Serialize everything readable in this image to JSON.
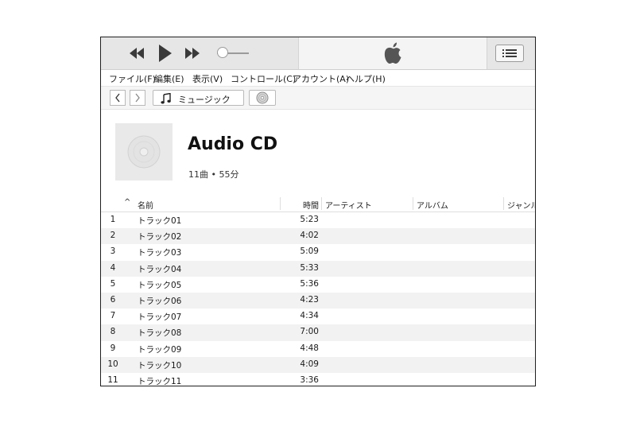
{
  "menu": [
    {
      "label": "ファイル(F)"
    },
    {
      "label": "編集(E)"
    },
    {
      "label": "表示(V)"
    },
    {
      "label": "コントロール(C)"
    },
    {
      "label": "アカウント(A)"
    },
    {
      "label": "ヘルプ(H)"
    }
  ],
  "player": {
    "icons": [
      "rewind-icon",
      "play-icon",
      "fast-forward-icon",
      "apple-logo-icon",
      "list-view-icon"
    ],
    "volume_level": 0.15
  },
  "nav": {
    "source_label": "ミュージック",
    "icons": [
      "back-arrow-icon",
      "forward-arrow-icon",
      "music-note-icon",
      "cd-icon"
    ]
  },
  "album": {
    "title": "Audio CD",
    "summary": "11曲 • 55分"
  },
  "table": {
    "sort_indicator": "^",
    "headers": {
      "name": "名前",
      "time": "時間",
      "artist": "アーティスト",
      "album": "アルバム",
      "genre": "ジャンル"
    },
    "rows": [
      {
        "num": "1",
        "name": "トラック01",
        "time": "5:23"
      },
      {
        "num": "2",
        "name": "トラック02",
        "time": "4:02"
      },
      {
        "num": "3",
        "name": "トラック03",
        "time": "5:09"
      },
      {
        "num": "4",
        "name": "トラック04",
        "time": "5:33"
      },
      {
        "num": "5",
        "name": "トラック05",
        "time": "5:36"
      },
      {
        "num": "6",
        "name": "トラック06",
        "time": "4:23"
      },
      {
        "num": "7",
        "name": "トラック07",
        "time": "4:34"
      },
      {
        "num": "8",
        "name": "トラック08",
        "time": "7:00"
      },
      {
        "num": "9",
        "name": "トラック09",
        "time": "4:48"
      },
      {
        "num": "10",
        "name": "トラック10",
        "time": "4:09"
      },
      {
        "num": "11",
        "name": "トラック11",
        "time": "3:36"
      }
    ]
  },
  "colors": {
    "toolbar": "#e6e6e6",
    "alt_row": "#f2f2f2",
    "border": "#1f1f1f"
  }
}
